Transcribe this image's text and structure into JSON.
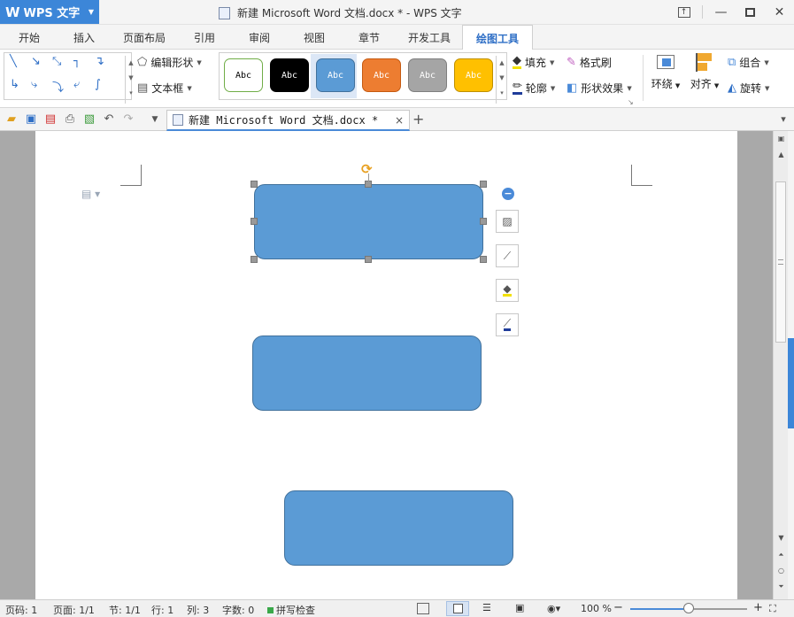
{
  "titlebar": {
    "app_name": "WPS 文字",
    "app_logo": "W",
    "doc_title": "新建 Microsoft Word 文档.docx * - WPS 文字"
  },
  "menu": {
    "tabs": [
      "开始",
      "插入",
      "页面布局",
      "引用",
      "审阅",
      "视图",
      "章节",
      "开发工具",
      "绘图工具"
    ],
    "active": "绘图工具"
  },
  "ribbon": {
    "edit_shape": "编辑形状",
    "text_box": "文本框",
    "style_sample": "Abc",
    "styles": [
      {
        "bg": "#ffffff",
        "border": "#70ad47",
        "fg": "#000000"
      },
      {
        "bg": "#000000",
        "border": "#000000",
        "fg": "#ffffff"
      },
      {
        "bg": "#5b9bd5",
        "border": "#41719c",
        "fg": "#ffffff"
      },
      {
        "bg": "#ed7d31",
        "border": "#c55a11",
        "fg": "#ffffff"
      },
      {
        "bg": "#a5a5a5",
        "border": "#7f7f7f",
        "fg": "#ffffff"
      },
      {
        "bg": "#ffc000",
        "border": "#bf9000",
        "fg": "#ffffff"
      }
    ],
    "selected_style_index": 2,
    "fill": "填充",
    "format_painter": "格式刷",
    "outline": "轮廓",
    "shape_effects": "形状效果",
    "wrap": "环绕",
    "align": "对齐",
    "group": "组合",
    "rotate": "旋转"
  },
  "doc_tab": {
    "name": "新建 Microsoft Word 文档.docx *",
    "close": "×",
    "add": "+"
  },
  "status": {
    "page": "页码: 1",
    "pages": "页面: 1/1",
    "section": "节: 1/1",
    "line": "行: 1",
    "column": "列: 3",
    "word_count": "字数: 0",
    "spell_check": "拼写检查",
    "zoom": "100 %",
    "zoom_fraction": 0.5
  },
  "colors": {
    "accent": "#3c86d8",
    "shape_fill": "#5b9bd5",
    "shape_border": "#41719c"
  }
}
